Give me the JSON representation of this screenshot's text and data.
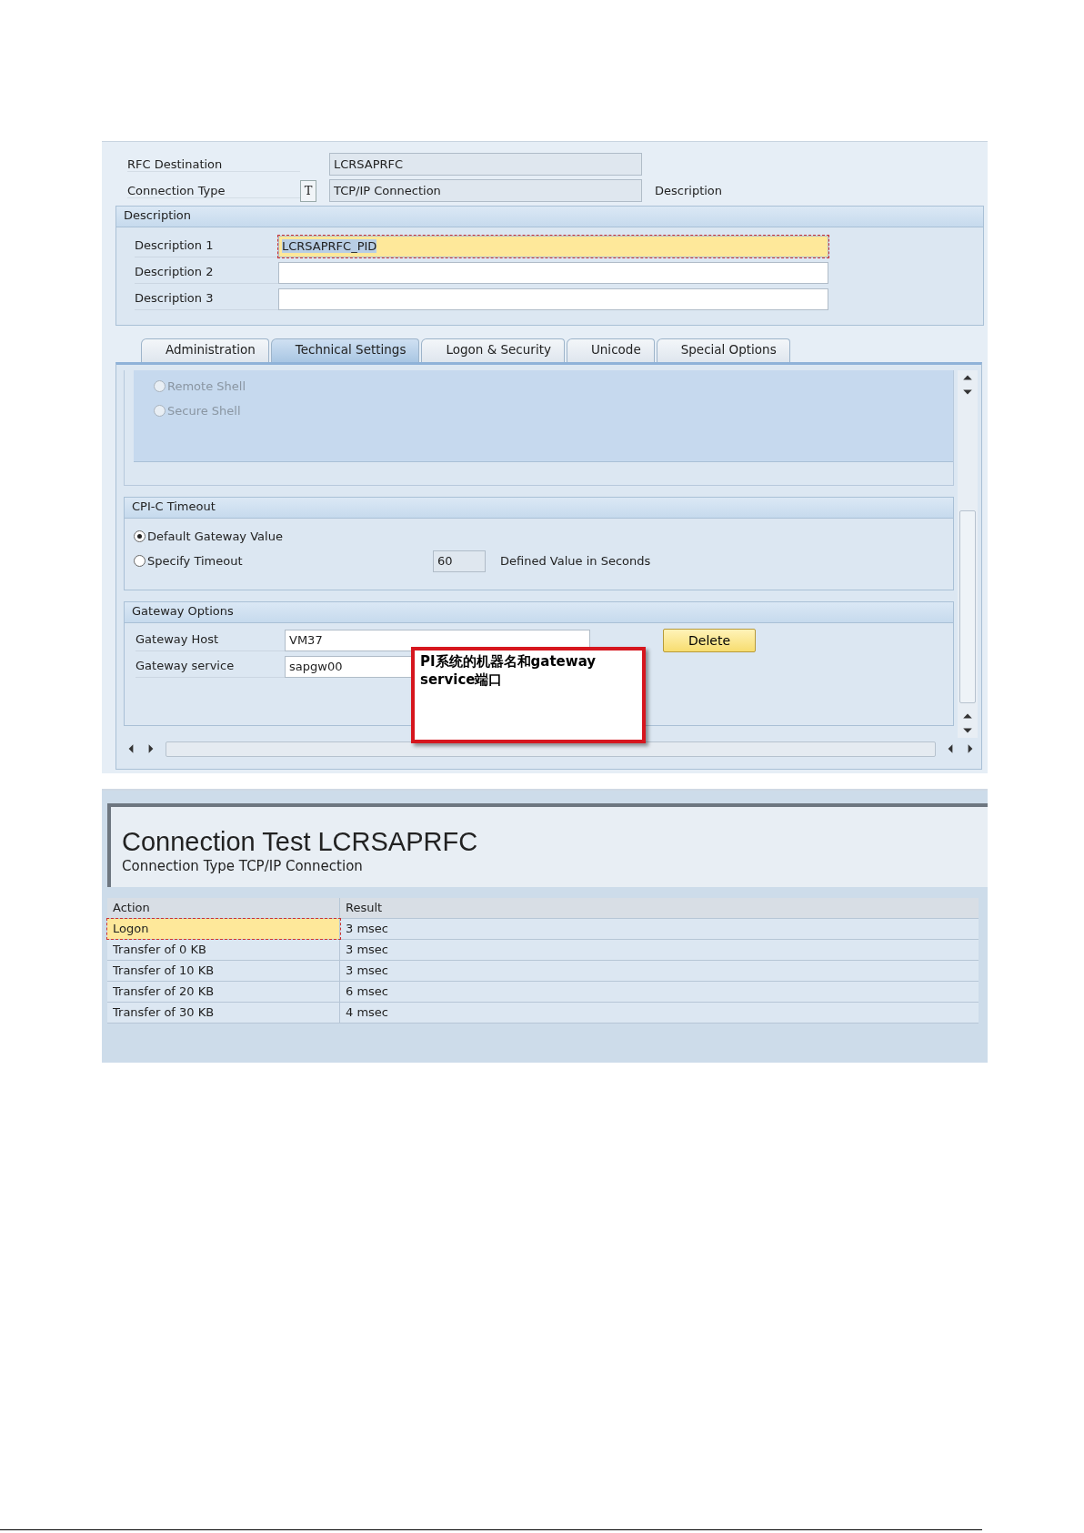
{
  "header_fields": [
    {
      "label": "RFC Destination",
      "value": "LCRSAPRFC"
    },
    {
      "label": "Connection Type",
      "code": "T",
      "value": "TCP/IP Connection",
      "note": "Description"
    }
  ],
  "description_group": {
    "title": "Description",
    "fields": [
      {
        "label": "Description 1",
        "value": "LCRSAPRFC_PID",
        "focused": true
      },
      {
        "label": "Description 2",
        "focused": false
      },
      {
        "label": "Description 3",
        "focused": false
      }
    ]
  },
  "tabs": [
    {
      "label": "Administration",
      "selected": false
    },
    {
      "label": "Technical Settings",
      "selected": true
    },
    {
      "label": "Logon & Security",
      "selected": false
    },
    {
      "label": "Unicode",
      "selected": false
    },
    {
      "label": "Special Options",
      "selected": false
    }
  ],
  "shell_group": {
    "options": [
      {
        "label": "Remote Shell",
        "selected": false,
        "disabled": true
      },
      {
        "label": "Secure Shell",
        "selected": false,
        "disabled": true
      }
    ]
  },
  "timeout_group": {
    "title": "CPI-C Timeout",
    "options": [
      {
        "label": "Default Gateway Value",
        "selected": true
      },
      {
        "label": "Specify Timeout",
        "selected": false
      }
    ],
    "value": "60",
    "value_label": "Defined Value in Seconds"
  },
  "gateway_group": {
    "title": "Gateway Options",
    "fields": [
      {
        "label": "Gateway Host",
        "value": "VM37"
      },
      {
        "label": "Gateway service",
        "value": "sapgw00"
      }
    ],
    "button": "Delete"
  },
  "callout": {
    "text": "PI系统的机器名和gateway service端口"
  },
  "test_result": {
    "title": "Connection Test LCRSAPRFC",
    "subtitle": "Connection Type TCP/IP Connection",
    "columns": [
      "Action",
      "Result"
    ],
    "rows": [
      {
        "cells": [
          "Logon",
          "3 msec"
        ],
        "selected": true
      },
      {
        "cells": [
          "Transfer of 0 KB",
          "3 msec"
        ],
        "selected": false
      },
      {
        "cells": [
          "Transfer of 10 KB",
          "3 msec"
        ],
        "selected": false
      },
      {
        "cells": [
          "Transfer of 20 KB",
          "6 msec"
        ],
        "selected": false
      },
      {
        "cells": [
          "Transfer of 30 KB",
          "4 msec"
        ],
        "selected": false
      }
    ]
  }
}
